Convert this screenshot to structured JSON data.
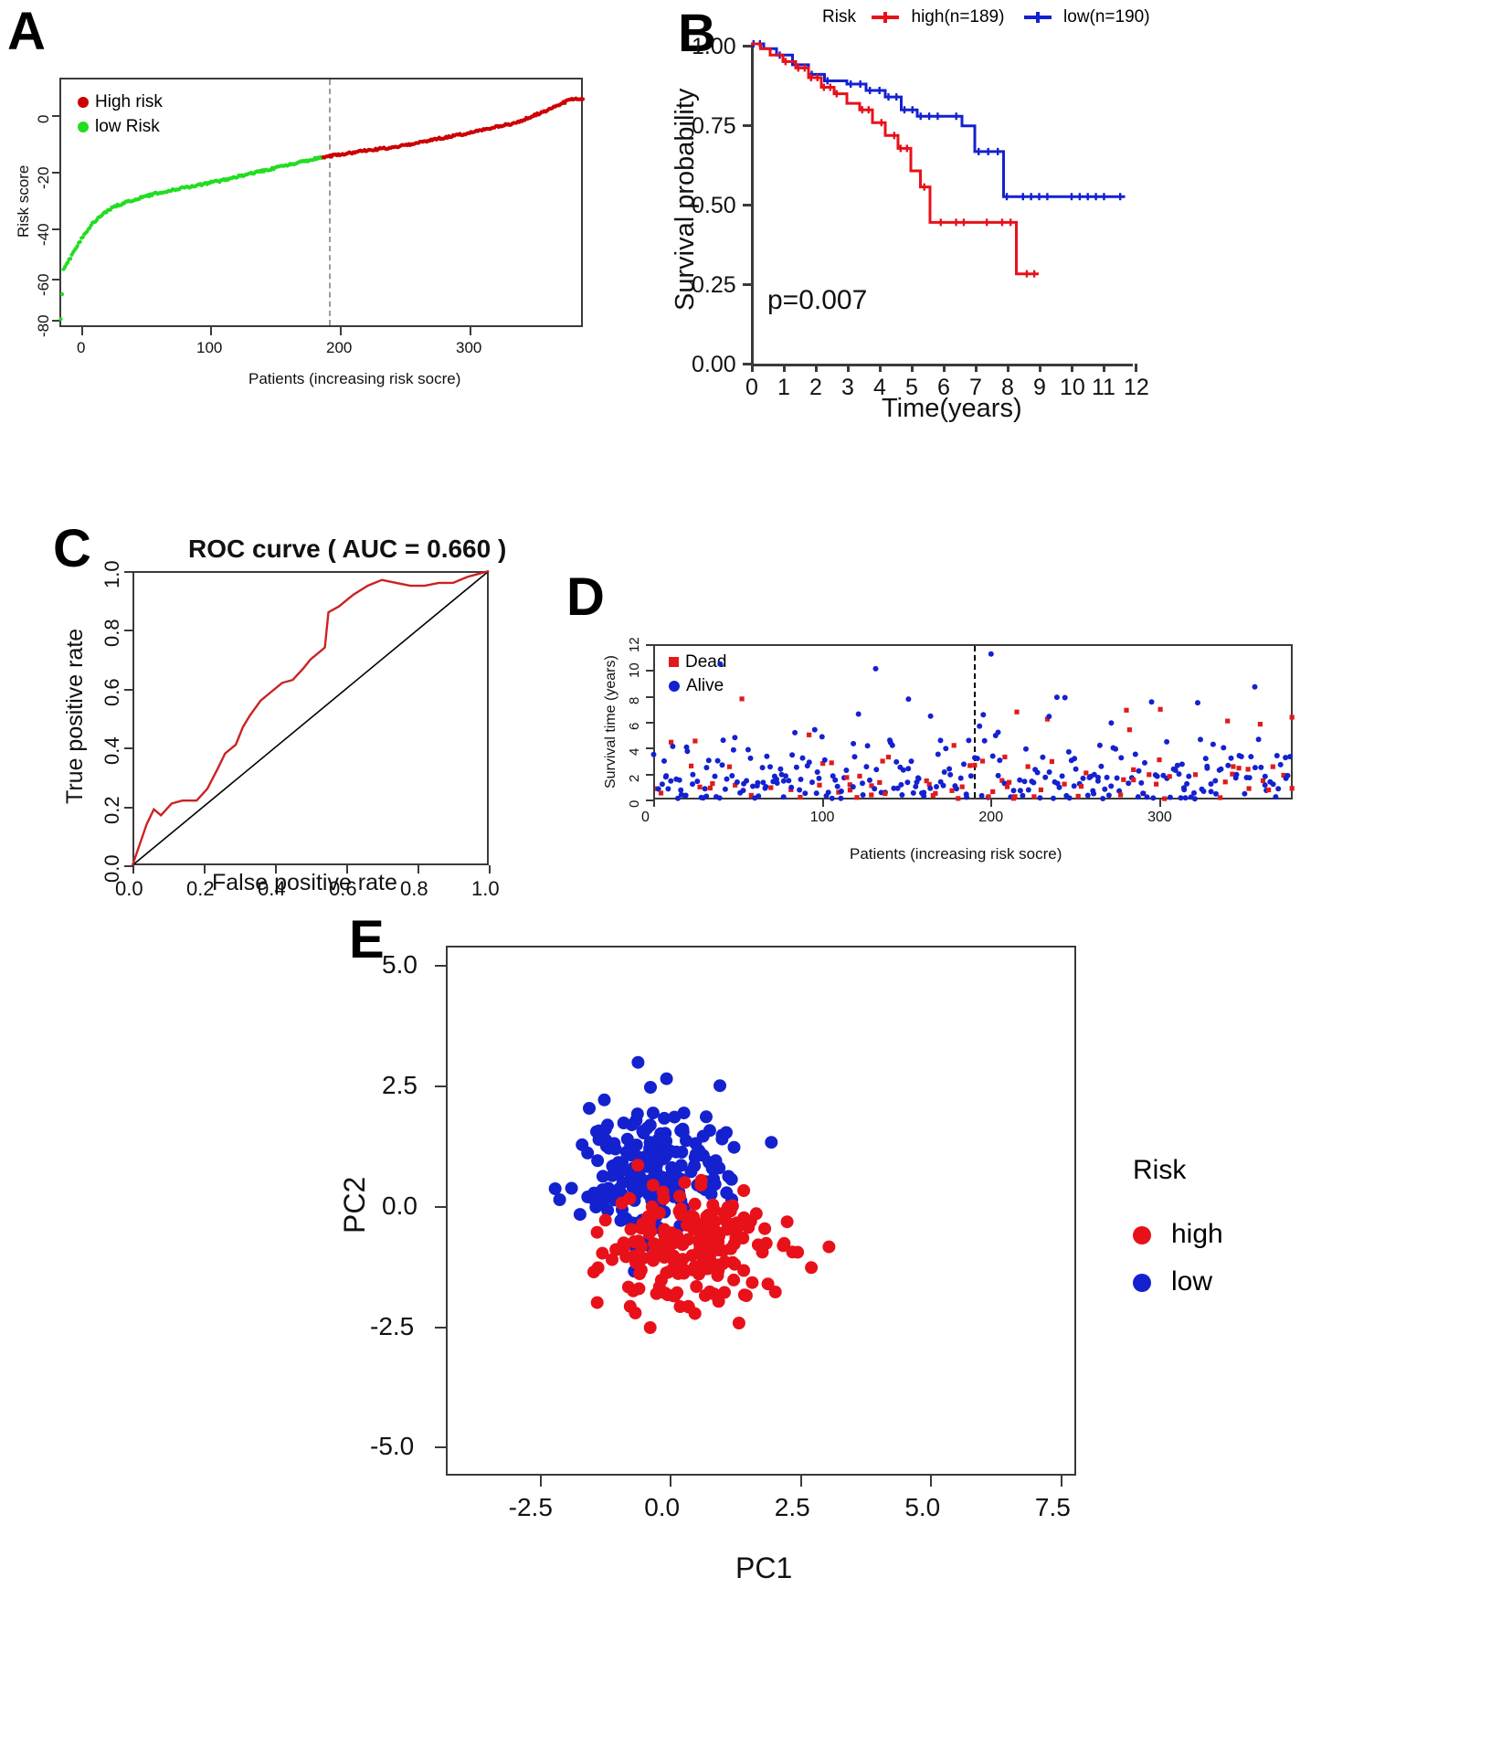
{
  "figure": {
    "panels": [
      "A",
      "B",
      "C",
      "D",
      "E"
    ]
  },
  "panelA": {
    "label": "A",
    "legend": [
      {
        "label": "High risk",
        "color": "#cc0000"
      },
      {
        "label": "low Risk",
        "color": "#22dd22"
      }
    ],
    "cutoff_label": "190",
    "chart_data": {
      "type": "scatter",
      "title": "",
      "xlabel": "Patients (increasing risk socre)",
      "ylabel": "Risk score",
      "xlim": [
        0,
        379
      ],
      "ylim": [
        -88,
        6
      ],
      "xticks": [
        "0",
        "100",
        "200",
        "300"
      ],
      "xtickvals": [
        0,
        100,
        200,
        300
      ],
      "yticks": [
        "0",
        "-20",
        "-40",
        "-60",
        "-80"
      ],
      "ytickvals": [
        0,
        -20,
        -40,
        -60,
        -80
      ],
      "cutoff_x": 190,
      "grid": false,
      "series": [
        {
          "name": "low Risk",
          "color": "#22dd22",
          "x_range": [
            1,
            190
          ],
          "y_range": [
            -85,
            -24
          ]
        },
        {
          "name": "High risk",
          "color": "#cc0000",
          "x_range": [
            190,
            379
          ],
          "y_range": [
            -24,
            5
          ]
        }
      ],
      "curve_points": [
        {
          "x": 1,
          "y": -85
        },
        {
          "x": 3,
          "y": -66
        },
        {
          "x": 5,
          "y": -64
        },
        {
          "x": 8,
          "y": -62
        },
        {
          "x": 12,
          "y": -58
        },
        {
          "x": 18,
          "y": -53
        },
        {
          "x": 24,
          "y": -49
        },
        {
          "x": 30,
          "y": -46
        },
        {
          "x": 38,
          "y": -43
        },
        {
          "x": 48,
          "y": -41
        },
        {
          "x": 60,
          "y": -39
        },
        {
          "x": 75,
          "y": -37
        },
        {
          "x": 95,
          "y": -35
        },
        {
          "x": 115,
          "y": -33
        },
        {
          "x": 140,
          "y": -30
        },
        {
          "x": 165,
          "y": -27
        },
        {
          "x": 190,
          "y": -24
        },
        {
          "x": 215,
          "y": -22
        },
        {
          "x": 245,
          "y": -20
        },
        {
          "x": 275,
          "y": -17
        },
        {
          "x": 305,
          "y": -14
        },
        {
          "x": 330,
          "y": -11
        },
        {
          "x": 350,
          "y": -7
        },
        {
          "x": 362,
          "y": -4
        },
        {
          "x": 372,
          "y": -2
        },
        {
          "x": 379,
          "y": -2
        }
      ]
    }
  },
  "panelB": {
    "label": "B",
    "legend_title": "Risk",
    "legend": [
      {
        "label": "high(n=189)",
        "color": "#e8111a"
      },
      {
        "label": "low(n=190)",
        "color": "#1421cf"
      }
    ],
    "pvalue": "p=0.007",
    "chart_data": {
      "type": "line",
      "title": "",
      "xlabel": "Time(years)",
      "ylabel": "Survival probability",
      "xlim": [
        0,
        12
      ],
      "ylim": [
        0,
        1.0
      ],
      "xticks": [
        "0",
        "1",
        "2",
        "3",
        "4",
        "5",
        "6",
        "7",
        "8",
        "9",
        "10",
        "11",
        "12"
      ],
      "yticks": [
        "0.00",
        "0.25",
        "0.50",
        "0.75",
        "1.00"
      ],
      "ytickvals": [
        0.0,
        0.25,
        0.5,
        0.75,
        1.0
      ],
      "grid": false,
      "legend_position": "top",
      "series": [
        {
          "name": "high(n=189)",
          "color": "#e8111a",
          "points": [
            {
              "t": 0.0,
              "s": 1.0
            },
            {
              "t": 0.3,
              "s": 0.985
            },
            {
              "t": 0.6,
              "s": 0.965
            },
            {
              "t": 1.0,
              "s": 0.945
            },
            {
              "t": 1.4,
              "s": 0.925
            },
            {
              "t": 1.8,
              "s": 0.895
            },
            {
              "t": 2.2,
              "s": 0.865
            },
            {
              "t": 2.6,
              "s": 0.845
            },
            {
              "t": 3.0,
              "s": 0.815
            },
            {
              "t": 3.4,
              "s": 0.795
            },
            {
              "t": 3.8,
              "s": 0.755
            },
            {
              "t": 4.2,
              "s": 0.715
            },
            {
              "t": 4.6,
              "s": 0.675
            },
            {
              "t": 5.0,
              "s": 0.605
            },
            {
              "t": 5.3,
              "s": 0.555
            },
            {
              "t": 5.6,
              "s": 0.445
            },
            {
              "t": 8.0,
              "s": 0.445
            },
            {
              "t": 8.3,
              "s": 0.285
            },
            {
              "t": 9.0,
              "s": 0.285
            }
          ]
        },
        {
          "name": "low(n=190)",
          "color": "#1421cf",
          "points": [
            {
              "t": 0.0,
              "s": 1.0
            },
            {
              "t": 0.4,
              "s": 0.985
            },
            {
              "t": 0.8,
              "s": 0.965
            },
            {
              "t": 1.3,
              "s": 0.935
            },
            {
              "t": 1.8,
              "s": 0.905
            },
            {
              "t": 2.3,
              "s": 0.885
            },
            {
              "t": 3.0,
              "s": 0.875
            },
            {
              "t": 3.6,
              "s": 0.855
            },
            {
              "t": 4.2,
              "s": 0.835
            },
            {
              "t": 4.7,
              "s": 0.795
            },
            {
              "t": 5.2,
              "s": 0.775
            },
            {
              "t": 6.0,
              "s": 0.775
            },
            {
              "t": 6.6,
              "s": 0.745
            },
            {
              "t": 7.0,
              "s": 0.665
            },
            {
              "t": 7.6,
              "s": 0.665
            },
            {
              "t": 7.9,
              "s": 0.525
            },
            {
              "t": 11.7,
              "s": 0.525
            }
          ]
        }
      ]
    }
  },
  "panelC": {
    "label": "C",
    "title": "ROC curve ( AUC =  0.660 )",
    "auc": "0.660",
    "chart_data": {
      "type": "line",
      "title": "ROC curve ( AUC =  0.660 )",
      "xlabel": "False positive rate",
      "ylabel": "True positive rate",
      "xlim": [
        0,
        1
      ],
      "ylim": [
        0,
        1
      ],
      "xticks": [
        "0.0",
        "0.2",
        "0.4",
        "0.6",
        "0.8",
        "1.0"
      ],
      "yticks": [
        "0.0",
        "0.2",
        "0.4",
        "0.6",
        "0.8",
        "1.0"
      ],
      "grid": false,
      "diagonal_reference": true,
      "curve_color": "#cc2222",
      "roc_points": [
        {
          "fpr": 0.0,
          "tpr": 0.0
        },
        {
          "fpr": 0.02,
          "tpr": 0.07
        },
        {
          "fpr": 0.04,
          "tpr": 0.14
        },
        {
          "fpr": 0.06,
          "tpr": 0.19
        },
        {
          "fpr": 0.08,
          "tpr": 0.17
        },
        {
          "fpr": 0.11,
          "tpr": 0.21
        },
        {
          "fpr": 0.14,
          "tpr": 0.22
        },
        {
          "fpr": 0.18,
          "tpr": 0.22
        },
        {
          "fpr": 0.21,
          "tpr": 0.26
        },
        {
          "fpr": 0.24,
          "tpr": 0.33
        },
        {
          "fpr": 0.26,
          "tpr": 0.38
        },
        {
          "fpr": 0.29,
          "tpr": 0.41
        },
        {
          "fpr": 0.31,
          "tpr": 0.47
        },
        {
          "fpr": 0.33,
          "tpr": 0.51
        },
        {
          "fpr": 0.36,
          "tpr": 0.56
        },
        {
          "fpr": 0.39,
          "tpr": 0.59
        },
        {
          "fpr": 0.42,
          "tpr": 0.62
        },
        {
          "fpr": 0.45,
          "tpr": 0.63
        },
        {
          "fpr": 0.48,
          "tpr": 0.67
        },
        {
          "fpr": 0.5,
          "tpr": 0.7
        },
        {
          "fpr": 0.52,
          "tpr": 0.72
        },
        {
          "fpr": 0.54,
          "tpr": 0.74
        },
        {
          "fpr": 0.55,
          "tpr": 0.86
        },
        {
          "fpr": 0.58,
          "tpr": 0.88
        },
        {
          "fpr": 0.62,
          "tpr": 0.92
        },
        {
          "fpr": 0.66,
          "tpr": 0.95
        },
        {
          "fpr": 0.7,
          "tpr": 0.97
        },
        {
          "fpr": 0.74,
          "tpr": 0.96
        },
        {
          "fpr": 0.78,
          "tpr": 0.95
        },
        {
          "fpr": 0.82,
          "tpr": 0.95
        },
        {
          "fpr": 0.86,
          "tpr": 0.96
        },
        {
          "fpr": 0.9,
          "tpr": 0.96
        },
        {
          "fpr": 0.94,
          "tpr": 0.98
        },
        {
          "fpr": 0.97,
          "tpr": 0.99
        },
        {
          "fpr": 1.0,
          "tpr": 1.0
        }
      ]
    }
  },
  "panelD": {
    "label": "D",
    "legend": [
      {
        "label": "Dead",
        "color": "#e01b1b",
        "shape": "square"
      },
      {
        "label": "Alive",
        "color": "#1421cf",
        "shape": "circle"
      }
    ],
    "chart_data": {
      "type": "scatter",
      "title": "",
      "xlabel": "Patients (increasing risk socre)",
      "ylabel": "Survival time (years)",
      "xlim": [
        0,
        379
      ],
      "ylim": [
        0,
        12
      ],
      "xticks": [
        "0",
        "100",
        "200",
        "300"
      ],
      "xtickvals": [
        0,
        100,
        200,
        300
      ],
      "yticks": [
        "0",
        "2",
        "4",
        "6",
        "8",
        "10",
        "12"
      ],
      "ytickvals": [
        0,
        2,
        4,
        6,
        8,
        10,
        12
      ],
      "cutoff_x": 190,
      "grid": false,
      "n_points_approx": 379
    }
  },
  "panelE": {
    "label": "E",
    "legend_title": "Risk",
    "legend": [
      {
        "label": "high",
        "color": "#e8111a"
      },
      {
        "label": "low",
        "color": "#1421cf"
      }
    ],
    "chart_data": {
      "type": "scatter",
      "title": "",
      "xlabel": "PC1",
      "ylabel": "PC2",
      "xlim": [
        -4.3,
        7.8
      ],
      "ylim": [
        -5.6,
        5.4
      ],
      "xticks": [
        "-2.5",
        "0.0",
        "2.5",
        "5.0",
        "7.5"
      ],
      "xtickvals": [
        -2.5,
        0.0,
        2.5,
        5.0,
        7.5
      ],
      "yticks": [
        "-5.0",
        "-2.5",
        "0.0",
        "2.5",
        "5.0"
      ],
      "ytickvals": [
        -5.0,
        -2.5,
        0.0,
        2.5,
        5.0
      ],
      "grid": false,
      "legend_position": "right",
      "series": [
        {
          "name": "high",
          "color": "#e8111a",
          "center": [
            0.2,
            -0.9
          ],
          "n_approx": 189
        },
        {
          "name": "low",
          "color": "#1421cf",
          "center": [
            -0.4,
            0.7
          ],
          "n_approx": 190
        }
      ]
    }
  }
}
